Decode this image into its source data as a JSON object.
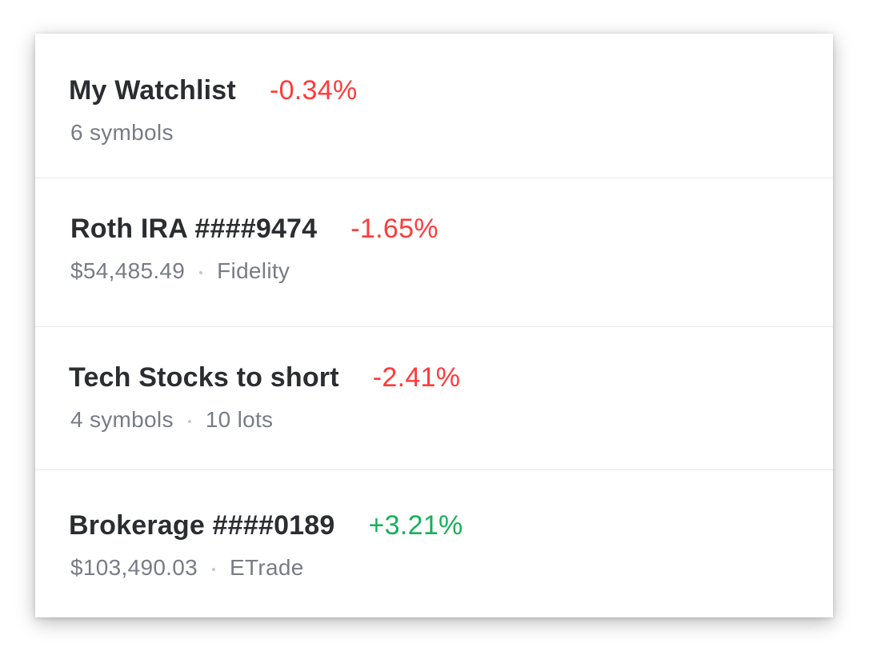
{
  "colors": {
    "negative": "#ff3b3b",
    "positive": "#16b05a",
    "title_text": "#2b2d31",
    "secondary_text": "#787c84"
  },
  "list": {
    "rows": [
      {
        "title": "My Watchlist",
        "change": "-0.34%",
        "direction": "negative",
        "meta": [
          "6 symbols"
        ]
      },
      {
        "title": "Roth IRA ####9474",
        "change": "-1.65%",
        "direction": "negative",
        "meta": [
          "$54,485.49",
          "Fidelity"
        ]
      },
      {
        "title": "Tech Stocks to short",
        "change": "-2.41%",
        "direction": "negative",
        "meta": [
          "4 symbols",
          "10 lots"
        ]
      },
      {
        "title": "Brokerage ####0189",
        "change": "+3.21%",
        "direction": "positive",
        "meta": [
          "$103,490.03",
          "ETrade"
        ]
      }
    ]
  }
}
